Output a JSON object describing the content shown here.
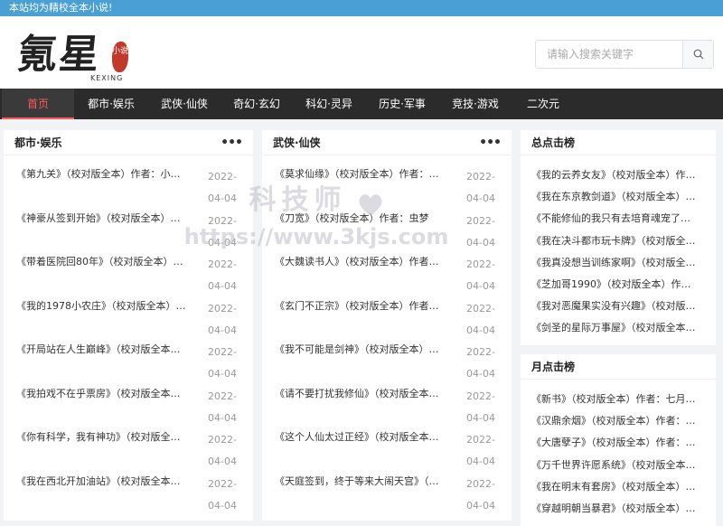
{
  "topbar": {
    "text": "本站均为精校全本小说!"
  },
  "logo": {
    "text": "氪星",
    "sub": "KEXING",
    "seal": "小说"
  },
  "search": {
    "placeholder": "请输入搜索关键字"
  },
  "nav": {
    "items": [
      {
        "label": "首页"
      },
      {
        "label": "都市·娱乐"
      },
      {
        "label": "武侠·仙侠"
      },
      {
        "label": "奇幻·玄幻"
      },
      {
        "label": "科幻·灵异"
      },
      {
        "label": "历史·军事"
      },
      {
        "label": "竞技·游戏"
      },
      {
        "label": "二次元"
      }
    ]
  },
  "panels": [
    {
      "title": "都市·娱乐",
      "rows": [
        {
          "title": "《第九关》（校对版全本）作者：小…",
          "date": "2022-04-04"
        },
        {
          "title": "《神豪从签到开始》（校对版全本）…",
          "date": "2022-04-04"
        },
        {
          "title": "《带着医院回80年》（校对版全本）…",
          "date": "2022-04-04"
        },
        {
          "title": "《我的1978小农庄》（校对版全本）…",
          "date": "2022-04-04"
        },
        {
          "title": "《开局站在人生巅峰》（校对版全本…",
          "date": "2022-04-04"
        },
        {
          "title": "《我拍戏不在乎票房》（校对版全本…",
          "date": "2022-04-04"
        },
        {
          "title": "《你有科学，我有神功》（校对版全…",
          "date": "2022-04-04"
        },
        {
          "title": "《我在西北开加油站》（校对版全本…",
          "date": "2022-04-04"
        }
      ]
    },
    {
      "title": "武侠·仙侠",
      "rows": [
        {
          "title": "《莫求仙缘》（校对版全本）作者：…",
          "date": "2022-04-04"
        },
        {
          "title": "《刀宽》（校对版全本）作者：虫梦",
          "date": "2022-04-04"
        },
        {
          "title": "《大魏读书人》（校对版全本）作者…",
          "date": "2022-04-04"
        },
        {
          "title": "《玄门不正宗》（校对版全本）作者…",
          "date": "2022-04-04"
        },
        {
          "title": "《我不可能是剑神》（校对版全本）…",
          "date": "2022-04-04"
        },
        {
          "title": "《请不要打扰我修仙》（校对版全本…",
          "date": "2022-04-04"
        },
        {
          "title": "《这个人仙太过正经》（校对版全本…",
          "date": "2022-04-04"
        },
        {
          "title": "《天庭签到，终于等来大闹天宫》（…",
          "date": "2022-04-04"
        }
      ]
    }
  ],
  "ranks": [
    {
      "title": "总点击榜",
      "rows": [
        "《我的云养女友》（校对版全本）作…",
        "《我在东京教剑道》（校对版全本）…",
        "《不能修仙的我只有去培育魂宠了》…",
        "《我在决斗都市玩卡牌》（校对版全…",
        "《我真没想当训练家啊》（校对版全…",
        "《芝加哥1990》（校对版全本）作者…",
        "《我对恶魔果实没有兴趣》（校对版…",
        "《剑圣的星际万事屋》（校对版全本…"
      ]
    },
    {
      "title": "月点击榜",
      "rows": [
        "《新书》（校对版全本）作者：七月…",
        "《汉鼎余烟》（校对版全本）作者：…",
        "《大唐孽子》（校对版全本）作者：…",
        "《万千世界许愿系统》（校对版全本…",
        "《我在明末有套房》（校对版全本）…",
        "《穿越明朝当暴君》（校对版全本）…"
      ]
    }
  ],
  "watermark": {
    "title": "科技师",
    "url": "https://www.3kjs.com"
  },
  "colors": {
    "topbar": "#4a9fd5",
    "nav_bg": "#2b2b2b",
    "nav_active": "#ff5b5b",
    "seal": "#c0392b"
  },
  "icons": {
    "search": "search-icon",
    "more": "more-icon"
  }
}
